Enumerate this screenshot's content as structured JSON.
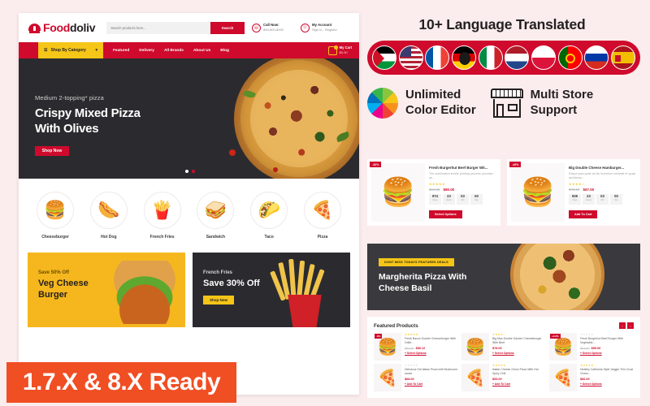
{
  "site": {
    "header": {
      "logo_text_a": "Food",
      "logo_text_b": "doliv",
      "search_placeholder": "Search products here...",
      "search_button": "Search",
      "call_label": "Call Now:",
      "call_number": "800-800-8000",
      "account_label": "My Account",
      "account_links": "Sign In - Register"
    },
    "nav": {
      "category_button": "Shop By Category",
      "links": [
        "Featured",
        "Delivery",
        "All Brands",
        "About Us",
        "Blog"
      ],
      "cart_label": "My Cart",
      "cart_total": "$0.00"
    },
    "hero": {
      "subtitle": "Medium 2-topping* pizza",
      "title_line1": "Crispy Mixed Pizza",
      "title_line2": "With Olives",
      "button": "Shop Now"
    },
    "categories": [
      {
        "label": "Cheeseburger",
        "icon": "burger-icon",
        "glyph": "🍔"
      },
      {
        "label": "Hot Dog",
        "icon": "hotdog-icon",
        "glyph": "🌭"
      },
      {
        "label": "French Fries",
        "icon": "fries-icon",
        "glyph": "🍟"
      },
      {
        "label": "Sandwich",
        "icon": "sandwich-icon",
        "glyph": "🥪"
      },
      {
        "label": "Taco",
        "icon": "taco-icon",
        "glyph": "🌮"
      },
      {
        "label": "Pizza",
        "icon": "pizza-icon",
        "glyph": "🍕"
      }
    ],
    "promos": [
      {
        "eyebrow": "Save 50% Off",
        "title_line1": "Veg Cheese",
        "title_line2": "Burger",
        "button": ""
      },
      {
        "eyebrow": "French Fries",
        "title_line1": "Save 30% Off",
        "title_line2": "",
        "button": "Shop Now"
      }
    ]
  },
  "panel": {
    "language_title": "10+ Language Translated",
    "flags": [
      {
        "name": "flag-palestine"
      },
      {
        "name": "flag-usa"
      },
      {
        "name": "flag-france"
      },
      {
        "name": "flag-germany"
      },
      {
        "name": "flag-italy"
      },
      {
        "name": "flag-netherlands"
      },
      {
        "name": "flag-poland"
      },
      {
        "name": "flag-portugal"
      },
      {
        "name": "flag-russia"
      },
      {
        "name": "flag-spain"
      }
    ],
    "features": [
      {
        "line1": "Unlimited",
        "line2": "Color Editor",
        "icon": "color-wheel-icon"
      },
      {
        "line1": "Multi Store",
        "line2": "Support",
        "icon": "storefront-icon"
      }
    ],
    "deals": [
      {
        "badge": "-30%",
        "name": "Fresh Burgerhut Beef Burger Wit...",
        "desc": "The sublimation textile printing process provides an...",
        "stars": "★★★★★",
        "old_price": "$64.00",
        "new_price": "$80.00",
        "timer": [
          {
            "num": "974",
            "label": "Days"
          },
          {
            "num": "23",
            "label": "Hours"
          },
          {
            "num": "03",
            "label": "Min"
          },
          {
            "num": "00",
            "label": "Sec"
          }
        ],
        "button": "Select Options",
        "glyph": "🍔"
      },
      {
        "badge": "-45%",
        "name": "Big Double Cheese Hamburger...",
        "desc": "Eaque ipsa quae ab illo inventore veritatis et quasi architecto...",
        "stars": "★★★★☆",
        "old_price": "$70.00",
        "new_price": "$67.00",
        "timer": [
          {
            "num": "929",
            "label": "Days"
          },
          {
            "num": "23",
            "label": "Hours"
          },
          {
            "num": "03",
            "label": "Min"
          },
          {
            "num": "00",
            "label": "Sec"
          }
        ],
        "button": "Add To Cart",
        "glyph": "🍔"
      }
    ],
    "pizza_banner": {
      "badge": "DONT MISS TODAYS FEATURES DEALS",
      "title_line1": "Margherita Pizza With",
      "title_line2": "Cheese Basil"
    },
    "featured": {
      "title": "Featured Products",
      "nav_prev": "‹",
      "nav_next": "›",
      "products": [
        {
          "badge": "-8%",
          "stars": "★★★★★",
          "name": "Fresh Bacon Double Cheeseburger With Grille...",
          "old_price": "$61.00",
          "new_price": "$56.12",
          "link": "+ Select Options",
          "glyph": "🍔"
        },
        {
          "badge": "",
          "stars": "★★★★☆",
          "name": "Big Mac Double Garden Cheeseburger With Beef",
          "old_price": "",
          "new_price": "$78.00",
          "link": "+ Select Options",
          "glyph": "🍔"
        },
        {
          "badge": "+9.2%",
          "stars": "★★★★★",
          "name": "Fresh Burgerhut Beef Burger With Vegetable...",
          "old_price": "$64.00",
          "new_price": "$59.00",
          "link": "+ Select Options",
          "glyph": "🍔"
        },
        {
          "badge": "",
          "stars": "★★★★★",
          "name": "Delicious Hot Italian Pizza with Mushroom sauce",
          "old_price": "",
          "new_price": "$68.00",
          "link": "+ Add To Cart",
          "glyph": "🍕"
        },
        {
          "badge": "",
          "stars": "★★★★★",
          "name": "Italian Cheese Onion Pizza With Hot Spicy Chili",
          "old_price": "",
          "new_price": "$93.00",
          "link": "+ Add To Cart",
          "glyph": "🍕"
        },
        {
          "badge": "",
          "stars": "★★★★★",
          "name": "Healthy California Style Veggie Thin Crust Chees...",
          "old_price": "",
          "new_price": "$66.00",
          "link": "+ Select Options",
          "glyph": "🍕"
        }
      ]
    }
  },
  "ready_banner": {
    "text": "1.7.X & 8.X Ready"
  }
}
